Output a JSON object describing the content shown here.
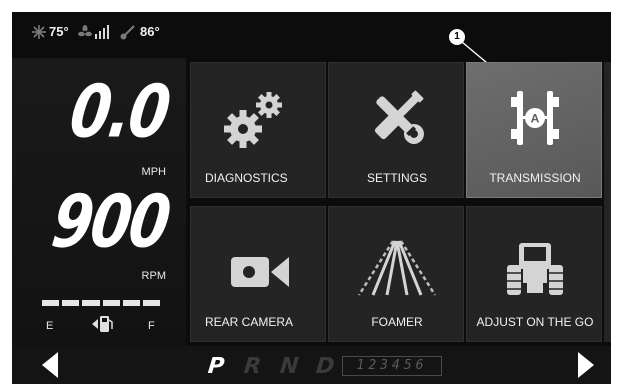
{
  "status_bar": {
    "cab_temp": "75°",
    "fan_icon": "fan-icon",
    "signal_icon": "signal-bars-icon",
    "engine_temp": "86°",
    "snowflake_icon": "snowflake-icon",
    "coolant_icon": "coolant-temp-icon"
  },
  "gauges": {
    "speed_value": "0.0",
    "speed_unit": "MPH",
    "rpm_value": "900",
    "rpm_unit": "RPM",
    "fuel_empty_label": "E",
    "fuel_full_label": "F",
    "fuel_level": 1.0,
    "fuel_icon": "fuel-pump-icon"
  },
  "tiles": [
    {
      "label": "DIAGNOSTICS",
      "icon": "gears-icon",
      "active": false
    },
    {
      "label": "SETTINGS",
      "icon": "wrench-screwdriver-icon",
      "active": false
    },
    {
      "label": "TRANSMISSION",
      "icon": "transmission-icon",
      "active": true
    },
    {
      "label": "REAR CAMERA",
      "icon": "video-camera-icon",
      "active": false
    },
    {
      "label": "FOAMER",
      "icon": "foamer-lines-icon",
      "active": false
    },
    {
      "label": "ADJUST ON THE GO",
      "icon": "tractor-icon",
      "active": false
    }
  ],
  "transmission_icon_letter": "A",
  "callout": {
    "number": "1"
  },
  "gear_bar": {
    "gears": [
      "P",
      "R",
      "N",
      "D"
    ],
    "selected_gear": "P",
    "ratios": "123456",
    "prev_icon": "arrow-left-icon",
    "next_icon": "arrow-right-icon"
  },
  "colors": {
    "background": "#0c0c0c",
    "tile": "#242424",
    "tile_active": "#6e6e6e",
    "text": "#ffffff",
    "inactive_gear": "#4a4a4a"
  }
}
